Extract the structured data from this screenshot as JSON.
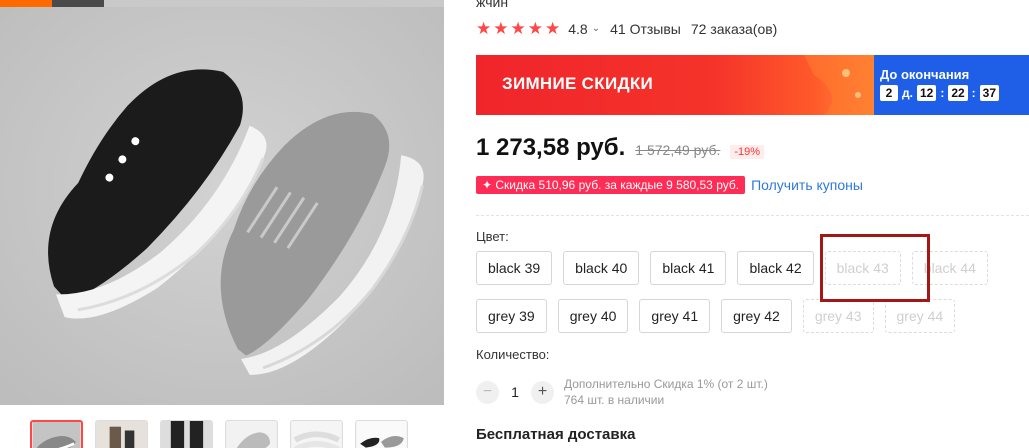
{
  "product": {
    "title_fragment": "жчин",
    "rating": "4.8",
    "reviews": "41 Отзывы",
    "orders": "72 заказа(ов)"
  },
  "promo": {
    "title": "ЗИМНИЕ СКИДКИ",
    "until": "До окончания",
    "days": "2",
    "days_unit": "д.",
    "hours": "12",
    "minutes": "22",
    "seconds": "37",
    "colors": {
      "banner": "#f0252b",
      "timer": "#1f5fe8"
    }
  },
  "price": {
    "current": "1 273,58 руб.",
    "old": "1 572,49 руб.",
    "discount": "-19%"
  },
  "coupon": {
    "badge": "✦ Скидка 510,96 руб. за каждые 9 580,53 руб.",
    "link": "Получить купоны"
  },
  "variants": {
    "label": "Цвет:",
    "rows": [
      [
        {
          "label": "black 39",
          "available": true
        },
        {
          "label": "black 40",
          "available": true
        },
        {
          "label": "black 41",
          "available": true
        },
        {
          "label": "black 42",
          "available": true
        },
        {
          "label": "black 43",
          "available": false
        },
        {
          "label": "black 44",
          "available": false
        }
      ],
      [
        {
          "label": "grey 39",
          "available": true
        },
        {
          "label": "grey 40",
          "available": true
        },
        {
          "label": "grey 41",
          "available": true
        },
        {
          "label": "grey 42",
          "available": true
        },
        {
          "label": "grey 43",
          "available": false
        },
        {
          "label": "grey 44",
          "available": false
        }
      ]
    ]
  },
  "quantity": {
    "label": "Количество:",
    "minus": "−",
    "plus": "+",
    "value": "1",
    "extra_discount": "Дополнительно Скидка 1% (от 2 шт.)",
    "stock": "764 шт. в наличии"
  },
  "shipping": {
    "label": "Бесплатная доставка"
  },
  "icons": [
    "star-icon",
    "chevron-down-icon",
    "minus-icon",
    "plus-icon"
  ]
}
